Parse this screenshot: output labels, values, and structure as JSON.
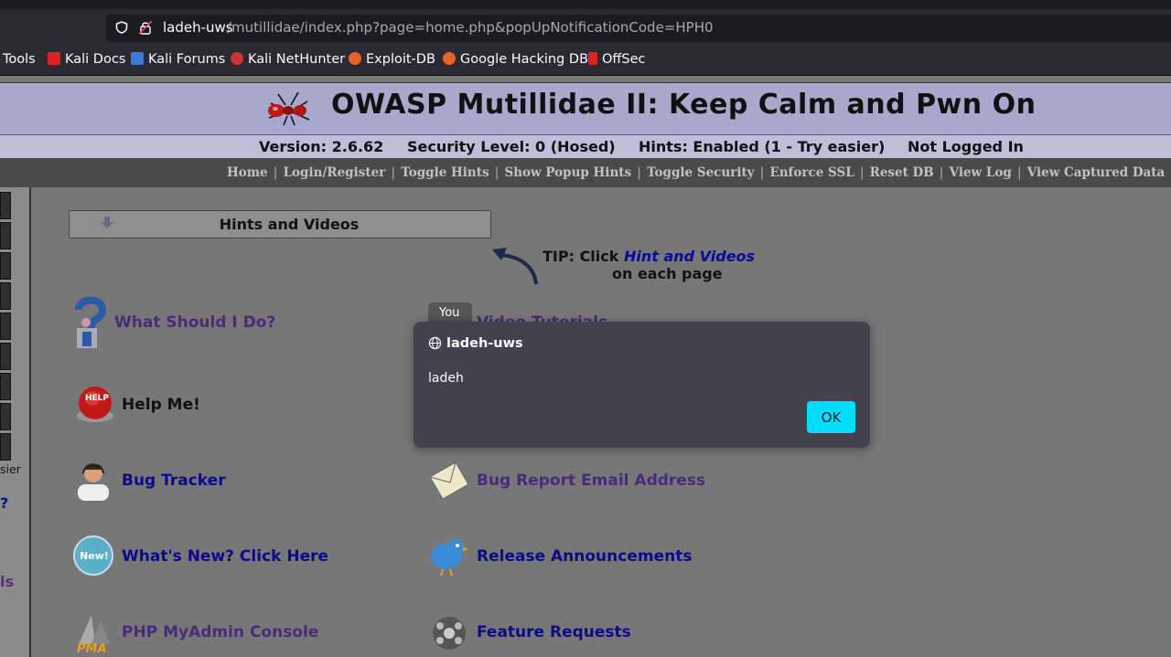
{
  "browser": {
    "url_host": "ladeh-uws",
    "url_path": "/mutillidae/index.php?page=home.php&popUpNotificationCode=HPH0",
    "bookmarks": [
      {
        "label": "Tools"
      },
      {
        "label": "Kali Docs"
      },
      {
        "label": "Kali Forums"
      },
      {
        "label": "Kali NetHunter"
      },
      {
        "label": "Exploit-DB"
      },
      {
        "label": "Google Hacking DB"
      },
      {
        "label": "OffSec"
      }
    ]
  },
  "header": {
    "title": "OWASP Mutillidae II: Keep Calm and Pwn On",
    "version": "Version: 2.6.62",
    "security": "Security Level: 0 (Hosed)",
    "hints": "Hints: Enabled (1 - Try easier)",
    "login": "Not Logged In"
  },
  "menu": {
    "items": [
      "Home",
      "Login/Register",
      "Toggle Hints",
      "Show Popup Hints",
      "Toggle Security",
      "Enforce SSL",
      "Reset DB",
      "View Log",
      "View Captured Data"
    ]
  },
  "leftnav": {
    "easier": "sier",
    "q": "?",
    "ls": "ls"
  },
  "content": {
    "hints_box": "Hints and Videos",
    "tip_prefix": "TIP: Click ",
    "tip_link": "Hint and Videos",
    "tip_suffix": "on each page",
    "tiles": {
      "what_should": "What Should I Do?",
      "video_tutorials": "Video Tutorials",
      "help_me": "Help Me!",
      "bug_tracker": "Bug Tracker",
      "bug_report": "Bug Report Email Address",
      "whats_new": "What's New? Click Here",
      "release": "Release Announcements",
      "phpmyadmin": "PHP MyAdmin Console",
      "feature": "Feature Requests"
    },
    "icon_text": {
      "youtube": "You",
      "help": "HELP",
      "new": "New!",
      "pma": "PMA"
    }
  },
  "dialog": {
    "title": "ladeh-uws",
    "message": "ladeh",
    "ok": "OK"
  },
  "colors": {
    "accent": "#00ddff",
    "header_bg": "#a8a8cc",
    "menu_bg": "#4a4a4a",
    "content_bg": "#777777"
  }
}
